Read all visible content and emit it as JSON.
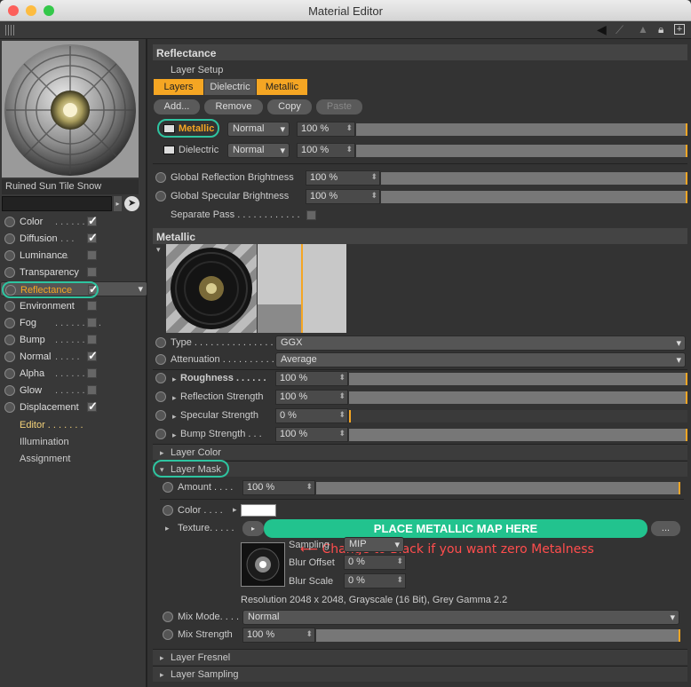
{
  "window": {
    "title": "Material Editor"
  },
  "material": {
    "name": "Ruined Sun Tile Snow"
  },
  "channels": [
    {
      "label": "Color",
      "dots": ". . . . . . .",
      "checked": true
    },
    {
      "label": "Diffusion",
      "dots": ". . . .",
      "checked": true
    },
    {
      "label": "Luminance",
      "dots": ". . .",
      "checked": false
    },
    {
      "label": "Transparency",
      "dots": "",
      "checked": false
    },
    {
      "label": "Reflectance",
      "dots": "",
      "checked": true
    },
    {
      "label": "Environment",
      "dots": "",
      "checked": false
    },
    {
      "label": "Fog",
      "dots": ". . . . . . . . .",
      "checked": false
    },
    {
      "label": "Bump",
      "dots": ". . . . . . .",
      "checked": false
    },
    {
      "label": "Normal",
      "dots": ". . . . .",
      "checked": true
    },
    {
      "label": "Alpha",
      "dots": ". . . . . . .",
      "checked": false
    },
    {
      "label": "Glow",
      "dots": ". . . . . . . .",
      "checked": false
    },
    {
      "label": "Displacement",
      "dots": "",
      "checked": true
    }
  ],
  "extra_items": [
    {
      "label": "Editor . . . . . . ."
    },
    {
      "label": "Illumination"
    },
    {
      "label": "Assignment"
    }
  ],
  "reflectance": {
    "header": "Reflectance",
    "layer_setup": "Layer Setup",
    "tabs": [
      "Layers",
      "Dielectric",
      "Metallic"
    ],
    "buttons": [
      "Add...",
      "Remove",
      "Copy",
      "Paste"
    ],
    "layers": [
      {
        "name": "Metallic",
        "blend": "Normal",
        "value": "100 %",
        "fill": 1.0
      },
      {
        "name": "Dielectric",
        "blend": "Normal",
        "value": "100 %",
        "fill": 1.0
      }
    ],
    "global_reflection_label": "Global Reflection Brightness",
    "global_reflection_value": "100 %",
    "global_specular_label": "Global Specular Brightness",
    "global_specular_value": "100 %",
    "separate_pass_label": "Separate Pass . . . . . . . . . . . ."
  },
  "metallic": {
    "header": "Metallic",
    "type_label": "Type . . . . . . . . . . . . . . .",
    "type_value": "GGX",
    "attenuation_label": "Attenuation . . . . . . . . . . .",
    "attenuation_value": "Average",
    "roughness_label": "Roughness . . . . . .",
    "roughness_value": "100 %",
    "refl_strength_label": "Reflection Strength",
    "refl_strength_value": "100 %",
    "spec_strength_label": "Specular Strength",
    "spec_strength_value": "0 %",
    "bump_strength_label": "Bump Strength . . .",
    "bump_strength_value": "100 %"
  },
  "layer_color": {
    "label": "Layer Color"
  },
  "layer_mask": {
    "label": "Layer Mask",
    "amount_label": "Amount . . . .",
    "amount_value": "100 %",
    "color_label": "Color . . . .",
    "annotation": "⟵ Change to Black if you want zero Metalness",
    "texture_label": "Texture. . . . .",
    "place_label": "PLACE METALLIC MAP HERE",
    "more_button": "...",
    "sampling_label": "Sampling",
    "sampling_value": "MIP",
    "blur_offset_label": "Blur Offset",
    "blur_offset_value": "0 %",
    "blur_scale_label": "Blur Scale",
    "blur_scale_value": "0 %",
    "resolution": "Resolution 2048 x 2048, Grayscale (16 Bit), Grey Gamma 2.2",
    "mix_mode_label": "Mix Mode. . . .",
    "mix_mode_value": "Normal",
    "mix_strength_label": "Mix Strength",
    "mix_strength_value": "100 %"
  },
  "layer_fresnel": {
    "label": "Layer Fresnel"
  },
  "layer_sampling": {
    "label": "Layer Sampling"
  },
  "colors": {
    "accent": "#f5a623",
    "highlight_ring": "#2ec4a0",
    "annotation": "#ff4d4d",
    "place_button": "#22c38e"
  }
}
